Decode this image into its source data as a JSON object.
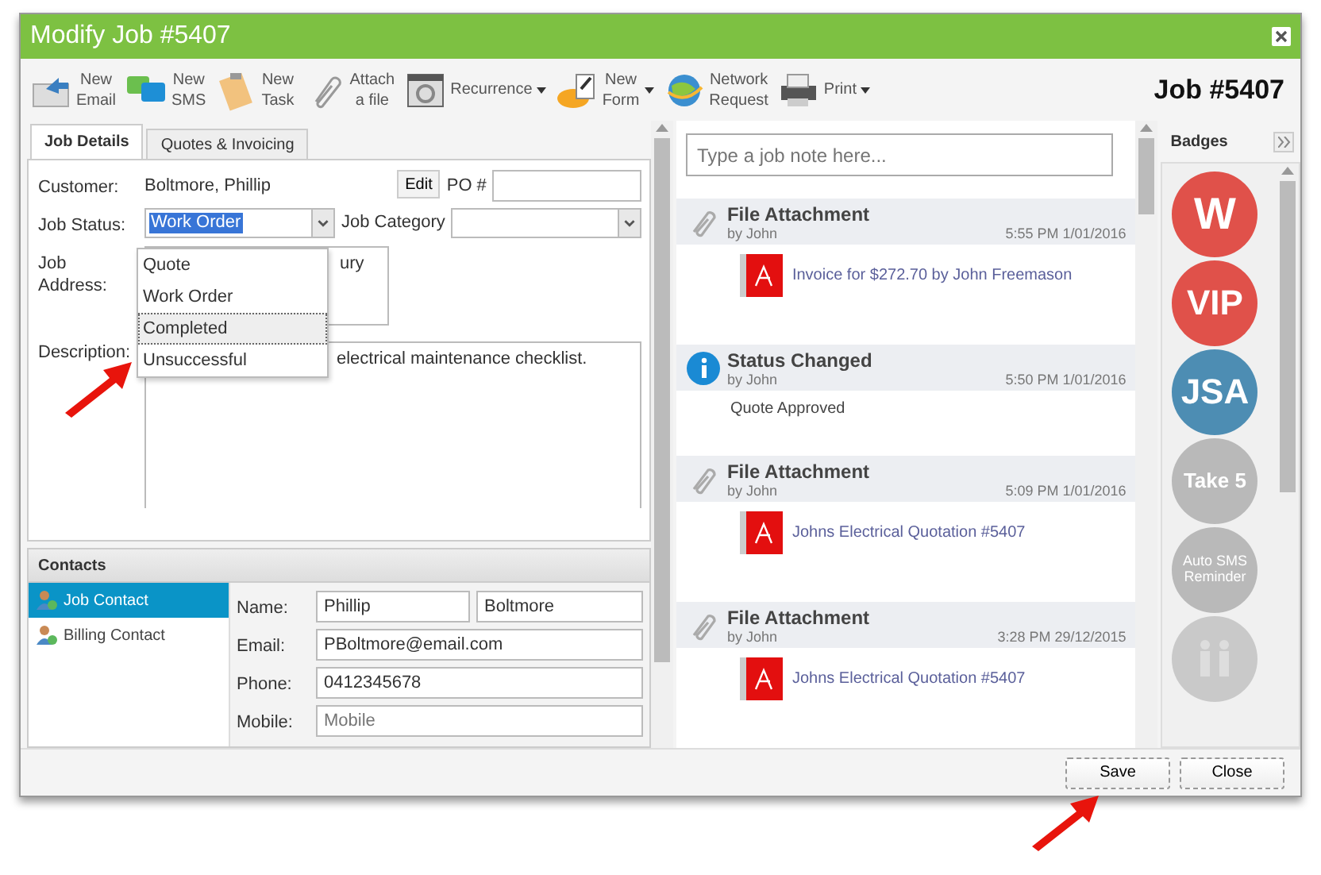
{
  "window": {
    "title": "Modify Job #5407",
    "job_number": "Job #5407"
  },
  "toolbar": [
    {
      "label": "New\nEmail",
      "menu": false
    },
    {
      "label": "New\nSMS",
      "menu": false
    },
    {
      "label": "New\nTask",
      "menu": false
    },
    {
      "label": "Attach\na file",
      "menu": false
    },
    {
      "label": "Recurrence",
      "menu": true
    },
    {
      "label": "New\nForm",
      "menu": true
    },
    {
      "label": "Network\nRequest",
      "menu": false
    },
    {
      "label": "Print",
      "menu": true
    }
  ],
  "tabs": [
    {
      "label": "Job Details",
      "selected": true
    },
    {
      "label": "Quotes & Invoicing",
      "selected": false
    }
  ],
  "form": {
    "customer_label": "Customer:",
    "customer": "Boltmore, Phillip",
    "edit": "Edit",
    "po_label": "PO #",
    "status_label": "Job Status:",
    "status": "Work Order",
    "category_label": "Job Category",
    "address_label": "Job\nAddress:",
    "address": "ury",
    "description_label": "Description:",
    "description": "electrical maintenance checklist."
  },
  "status_options": [
    {
      "label": "Quote",
      "selected": false
    },
    {
      "label": "Work Order",
      "selected": false
    },
    {
      "label": "Completed",
      "selected": true
    },
    {
      "label": "Unsuccessful",
      "selected": false
    }
  ],
  "contacts": {
    "title": "Contacts",
    "items": [
      {
        "label": "Job Contact",
        "selected": true
      },
      {
        "label": "Billing Contact",
        "selected": false
      }
    ],
    "name_label": "Name:",
    "first_name": "Phillip",
    "last_name": "Boltmore",
    "email_label": "Email:",
    "email": "PBoltmore@email.com",
    "phone_label": "Phone:",
    "phone": "0412345678",
    "mobile_label": "Mobile:",
    "mobile_placeholder": "Mobile"
  },
  "note": {
    "placeholder": "Type a job note here..."
  },
  "timeline": [
    {
      "kind": "attachment",
      "title": "File Attachment",
      "by": "by John",
      "time": "5:55 PM 1/01/2016",
      "body": "Invoice for $272.70 by John Freemason"
    },
    {
      "kind": "status",
      "title": "Status Changed",
      "by": "by John",
      "time": "5:50 PM 1/01/2016",
      "body": "Quote Approved"
    },
    {
      "kind": "attachment",
      "title": "File Attachment",
      "by": "by John",
      "time": "5:09 PM 1/01/2016",
      "body": "Johns Electrical Quotation #5407"
    },
    {
      "kind": "attachment",
      "title": "File Attachment",
      "by": "by John",
      "time": "3:28 PM 29/12/2015",
      "body": "Johns Electrical Quotation #5407"
    }
  ],
  "badges": {
    "title": "Badges",
    "items": [
      {
        "label": "W",
        "color": "#e0514a"
      },
      {
        "label": "VIP",
        "color": "#e0514a"
      },
      {
        "label": "JSA",
        "color": "#4d8db3"
      },
      {
        "label": "Take 5",
        "color": "#b9b9b9"
      },
      {
        "label": "Auto SMS\nReminder",
        "color": "#b9b9b9"
      },
      {
        "color": "#c9c9c9"
      }
    ]
  },
  "buttons": [
    {
      "label": "Save"
    },
    {
      "label": "Close"
    }
  ]
}
